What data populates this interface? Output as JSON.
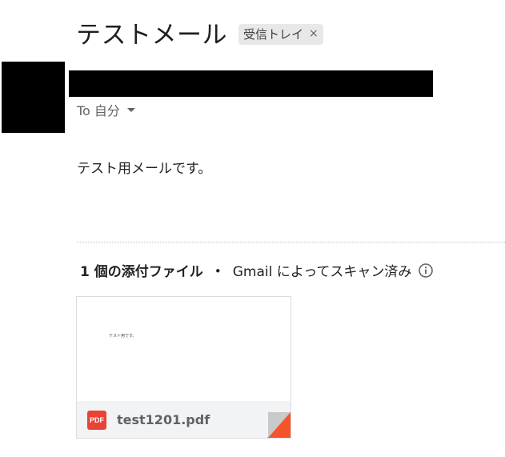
{
  "email": {
    "subject": "テストメール",
    "label_chip": "受信トレイ",
    "label_close": "×",
    "recipient_text": "To 自分",
    "body": "テスト用メールです。"
  },
  "attachments": {
    "count_label": "1 個の添付ファイル",
    "separator": "・",
    "scan_text": "Gmail によってスキャン済み",
    "info_icon": "info-icon",
    "files": [
      {
        "name": "test1201.pdf",
        "type_badge": "PDF",
        "preview_text": "テスト用です。"
      }
    ]
  },
  "colors": {
    "pdf_red": "#ea4335",
    "corner_red": "#f4532b",
    "card_footer": "#f1f3f4",
    "chip_bg": "#e8e8e8"
  }
}
